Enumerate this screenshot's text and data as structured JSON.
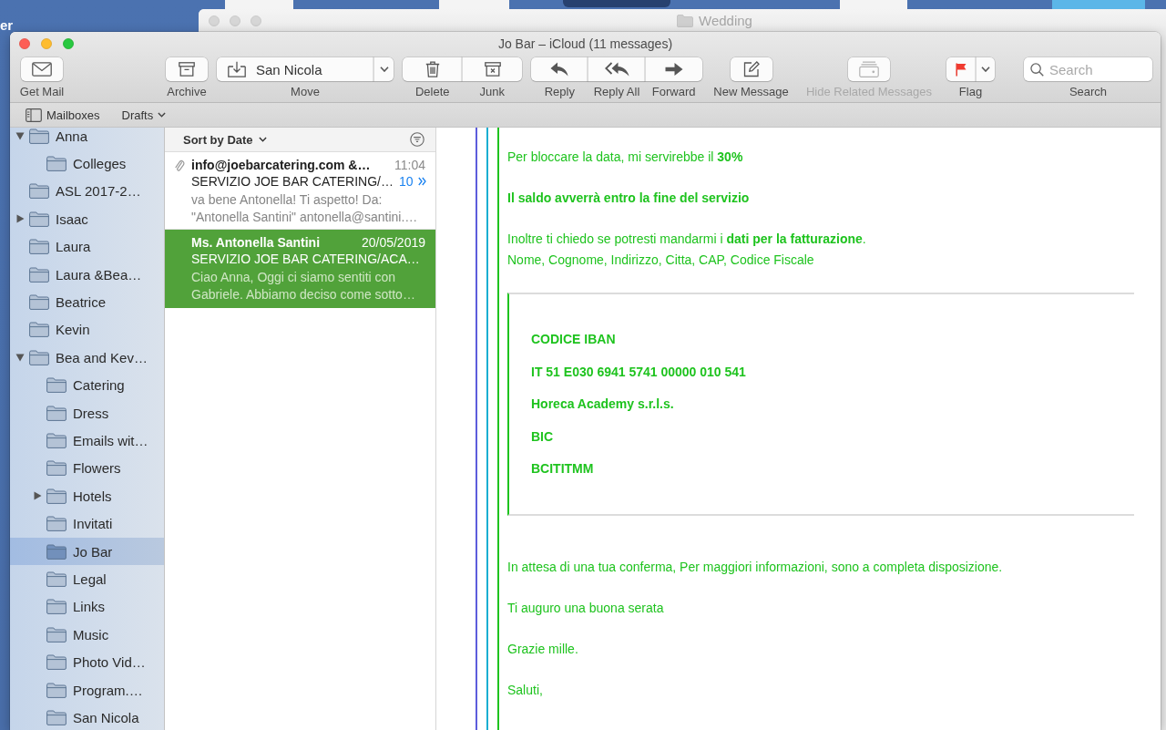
{
  "desktop": {
    "label": "er"
  },
  "background_window": {
    "title": "Wedding"
  },
  "window": {
    "title": "Jo Bar – iCloud (11 messages)"
  },
  "toolbar": [
    {
      "kind": "single",
      "items": [
        {
          "label": "Get Mail",
          "disabled": false
        }
      ]
    },
    {
      "kind": "single",
      "items": [
        {
          "label": "Archive",
          "disabled": false
        }
      ]
    },
    {
      "kind": "dropdown",
      "value": "San Nicola",
      "label": "Move",
      "disabled": false
    },
    {
      "kind": "segmented",
      "items": [
        {
          "label": "Delete",
          "disabled": false
        },
        {
          "label": "Junk",
          "disabled": false
        }
      ]
    },
    {
      "kind": "segmented",
      "items": [
        {
          "label": "Reply",
          "disabled": false
        },
        {
          "label": "Reply All",
          "disabled": false
        },
        {
          "label": "Forward",
          "disabled": false
        }
      ]
    },
    {
      "kind": "single",
      "items": [
        {
          "label": "New Message",
          "disabled": false
        }
      ]
    },
    {
      "kind": "single",
      "items": [
        {
          "label": "Hide Related Messages",
          "disabled": true
        }
      ]
    },
    {
      "kind": "split",
      "label": "Flag",
      "disabled": false
    },
    {
      "kind": "search",
      "placeholder": "Search",
      "label": "Search"
    }
  ],
  "favorites_bar": [
    {
      "label": "Mailboxes"
    },
    {
      "label": "Drafts"
    }
  ],
  "sidebar": {
    "items": [
      {
        "label": "Anna",
        "expanded": true,
        "selected": false,
        "children": [
          {
            "label": "Colleges",
            "selected": false
          }
        ]
      },
      {
        "label": "ASL 2017-2…",
        "selected": false
      },
      {
        "label": "Isaac",
        "expanded": false,
        "selected": false
      },
      {
        "label": "Laura",
        "selected": false
      },
      {
        "label": "Laura &Bea…",
        "selected": false
      },
      {
        "label": "Beatrice",
        "selected": false
      },
      {
        "label": "Kevin",
        "selected": false
      },
      {
        "label": "Bea and Kev…",
        "expanded": true,
        "selected": false,
        "children": [
          {
            "label": "Catering",
            "selected": false
          },
          {
            "label": "Dress",
            "selected": false
          },
          {
            "label": "Emails wit…",
            "selected": false
          },
          {
            "label": "Flowers",
            "selected": false
          },
          {
            "label": "Hotels",
            "expanded": false,
            "selected": false
          },
          {
            "label": "Invitati",
            "selected": false
          },
          {
            "label": "Jo Bar",
            "selected": true
          },
          {
            "label": "Legal",
            "selected": false
          },
          {
            "label": "Links",
            "selected": false
          },
          {
            "label": "Music",
            "selected": false
          },
          {
            "label": "Photo Vid…",
            "selected": false
          },
          {
            "label": "Program.…",
            "selected": false
          },
          {
            "label": "San Nicola",
            "selected": false
          }
        ]
      }
    ]
  },
  "message_list": {
    "sort_label": "Sort by Date",
    "messages": [
      {
        "sender": "info@joebarcatering.com &…",
        "time": "11:04",
        "subject": "SERVIZIO JOE BAR CATERING/…",
        "thread_count": "10",
        "preview": "va bene Antonella! Ti aspetto! Da:\n\"Antonella Santini\" antonella@santini.…",
        "attachment": true,
        "selected": false
      },
      {
        "sender": "Ms. Antonella Santini",
        "time": "20/05/2019",
        "subject": "SERVIZIO JOE BAR CATERING/ACA…",
        "preview": "Ciao Anna, Oggi ci siamo sentiti con\nGabriele. Abbiamo deciso come sotto…",
        "attachment": false,
        "selected": true
      }
    ]
  },
  "message": {
    "paragraphs_before": [
      {
        "text": "Per bloccare la data, mi servirebbe il **30%**",
        "bold": false
      },
      {
        "text": "Il saldo avverrà entro la fine del servizio",
        "bold": true
      },
      {
        "text": "Inoltre ti chiedo se potresti mandarmi i **dati per la fatturazione**.\nNome, Cognome, Indirizzo, Citta, CAP, Codice Fiscale",
        "bold": false
      }
    ],
    "bank_details": [
      "CODICE IBAN",
      "IT 51 E030 6941 5741 00000 010 541",
      "Horeca Academy s.r.l.s.",
      "BIC",
      "BCITITMM"
    ],
    "paragraphs_after": [
      {
        "text": "In attesa di una tua conferma, Per maggiori informazioni, sono a completa disposizione.",
        "bold": false
      },
      {
        "text": "Ti auguro una buona serata",
        "bold": false
      },
      {
        "text": "Grazie mille.",
        "bold": false
      },
      {
        "text": "Saluti,",
        "bold": false
      }
    ]
  }
}
